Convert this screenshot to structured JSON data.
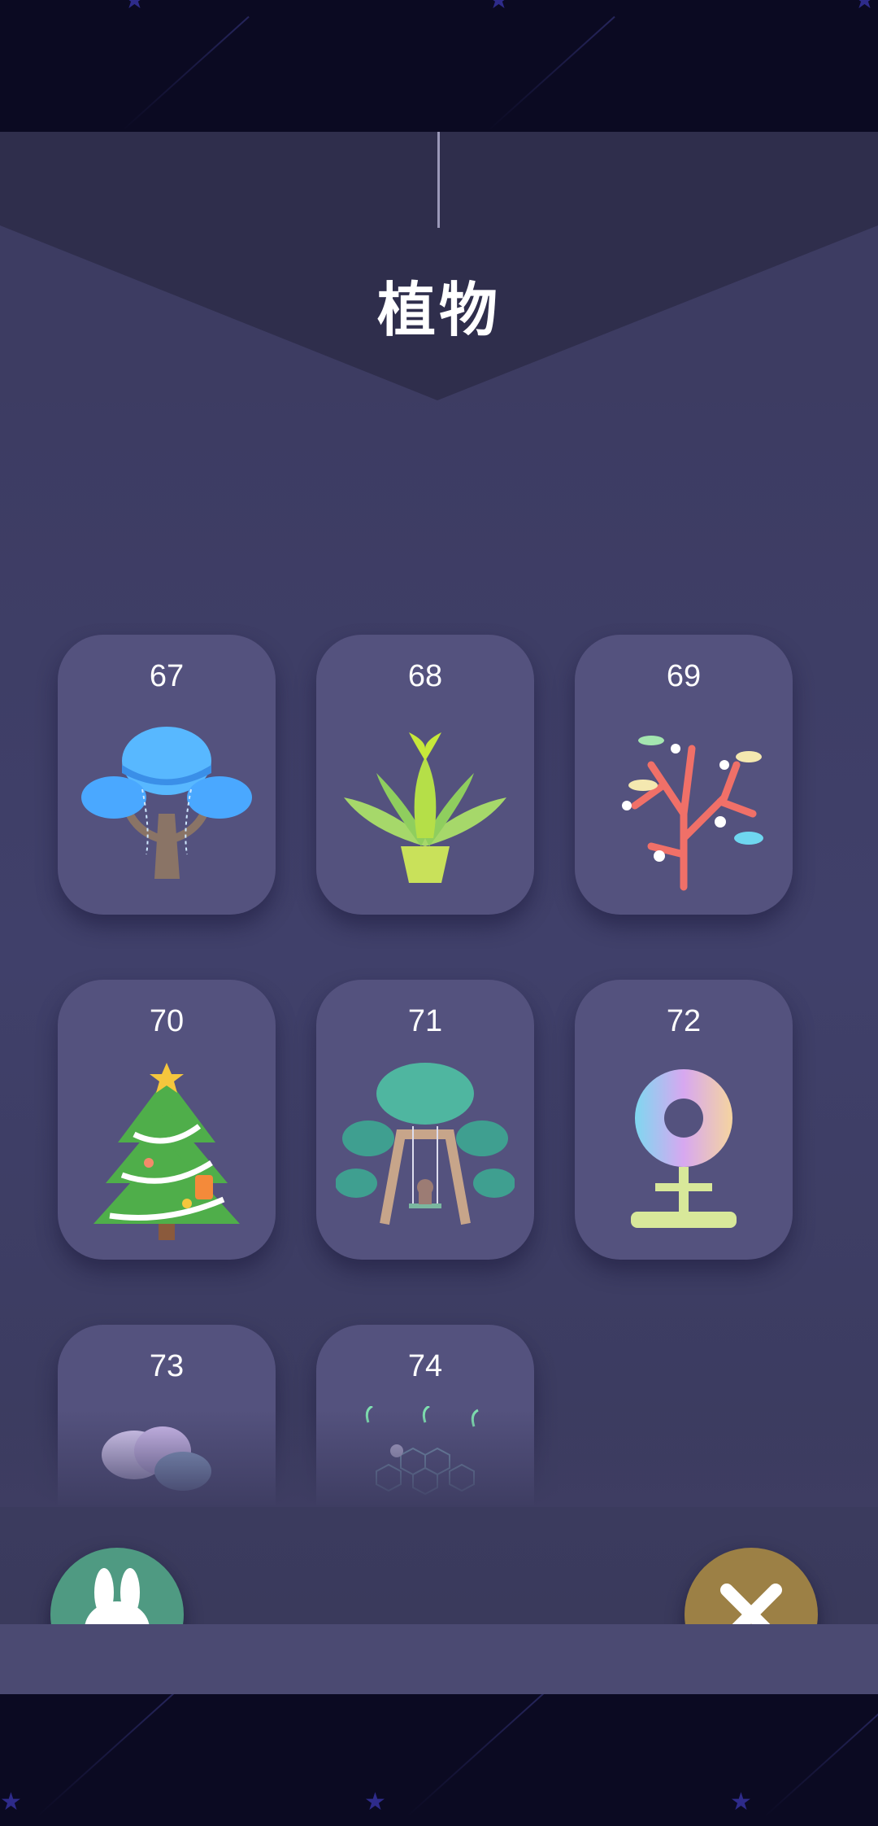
{
  "page": {
    "title": "植物"
  },
  "cards": [
    {
      "number": "67",
      "art": "jellyfish-tree-icon"
    },
    {
      "number": "68",
      "art": "mermaid-plant-icon"
    },
    {
      "number": "69",
      "art": "coral-tree-icon"
    },
    {
      "number": "70",
      "art": "christmas-tree-icon"
    },
    {
      "number": "71",
      "art": "swing-tree-icon"
    },
    {
      "number": "72",
      "art": "pixel-flower-icon"
    },
    {
      "number": "73",
      "art": "cloud-plant-icon"
    },
    {
      "number": "74",
      "art": "hexagon-sprout-icon"
    }
  ],
  "buttons": {
    "left": {
      "icon": "rabbit-icon",
      "color": "#4f9a82"
    },
    "right": {
      "icon": "close-icon",
      "color": "#9c8045"
    }
  },
  "colors": {
    "space": "#0b0a22",
    "panel": "#3f3e66",
    "card": "#54527e"
  }
}
